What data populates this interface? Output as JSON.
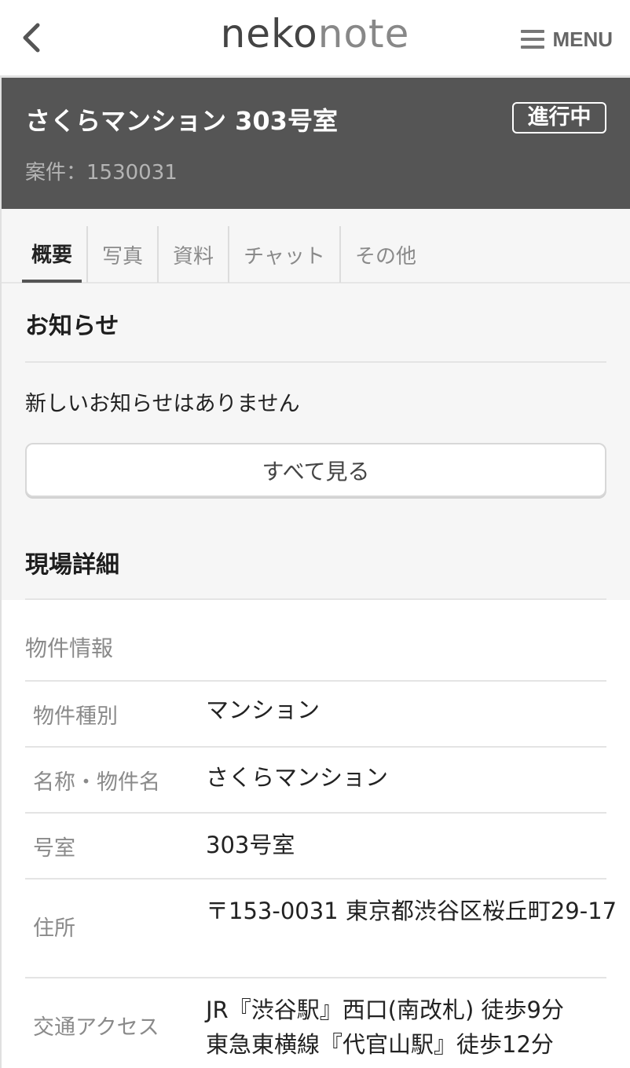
{
  "header": {
    "logo_part1": "neko",
    "logo_part2": "note",
    "menu_label": "MENU"
  },
  "project": {
    "title": "さくらマンション 303号室",
    "status": "進行中",
    "case_id": "案件：1530031"
  },
  "tabs": [
    {
      "label": "概要",
      "active": true
    },
    {
      "label": "写真"
    },
    {
      "label": "資料"
    },
    {
      "label": "チャット"
    },
    {
      "label": "その他"
    }
  ],
  "notices": {
    "heading": "お知らせ",
    "empty_text": "新しいお知らせはありません",
    "see_all_label": "すべて見る"
  },
  "details": {
    "heading": "現場詳細",
    "sub_heading": "物件情報",
    "rows": [
      {
        "label": "物件種別",
        "value": "マンション"
      },
      {
        "label": "名称・物件名",
        "value": "さくらマンション"
      },
      {
        "label": "号室",
        "value": "303号室"
      },
      {
        "label": "住所",
        "value": "〒153-0031 東京都渋谷区桜丘町29-17"
      },
      {
        "label": "交通アクセス",
        "value_line1": "JR『渋谷駅』西口(南改札) 徒歩9分",
        "value_line2": "東急東横線『代官山駅』徒歩12分"
      }
    ]
  },
  "colors": {
    "banner_bg": "#555555",
    "gray_bg": "#f6f6f6",
    "label_gray": "#8a8a8a"
  }
}
